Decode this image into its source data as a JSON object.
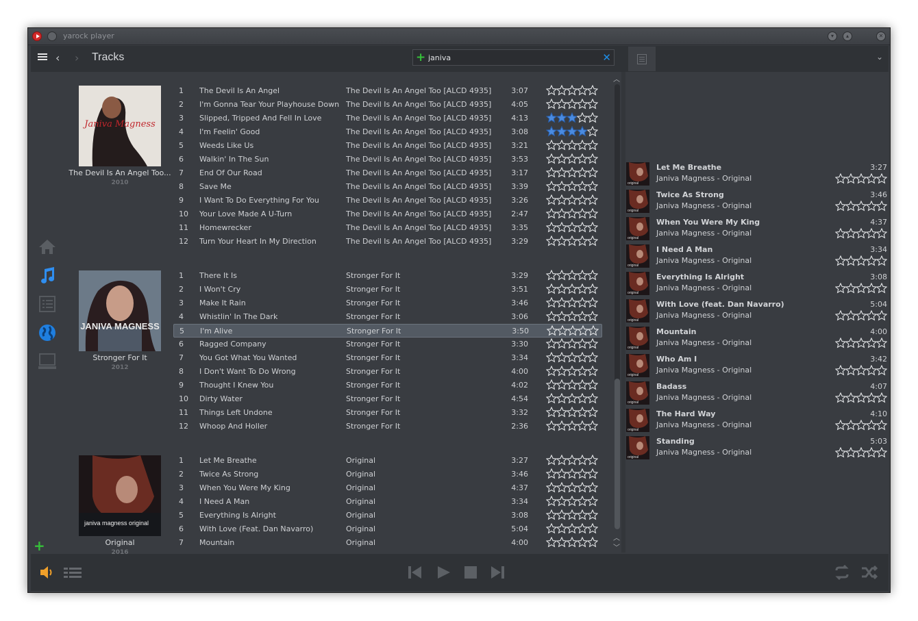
{
  "window": {
    "title": "yarock player"
  },
  "toolbar": {
    "page_title": "Tracks",
    "search_value": "janiva"
  },
  "colors": {
    "accent": "#1e8ee8",
    "add_green": "#36c03a",
    "volume_orange": "#f0a02a",
    "star_filled": "#4a8be0"
  },
  "sidebar": {
    "items": [
      {
        "name": "home",
        "icon": "home-icon"
      },
      {
        "name": "music",
        "icon": "music-note-icon",
        "active": true
      },
      {
        "name": "playlists",
        "icon": "list-icon"
      },
      {
        "name": "radio",
        "icon": "globe-icon"
      },
      {
        "name": "devices",
        "icon": "computer-icon"
      }
    ]
  },
  "albums": [
    {
      "title": "The Devil Is An Angel Too...",
      "year": "2010",
      "cover_text": "Janiva Magness",
      "tracks": [
        {
          "no": "1",
          "title": "The Devil Is An Angel",
          "album": "The Devil Is An Angel Too [ALCD 4935]",
          "duration": "3:07",
          "rating": 0
        },
        {
          "no": "2",
          "title": "I'm Gonna Tear Your Playhouse Down",
          "album": "The Devil Is An Angel Too [ALCD 4935]",
          "duration": "4:05",
          "rating": 0
        },
        {
          "no": "3",
          "title": "Slipped, Tripped And Fell In Love",
          "album": "The Devil Is An Angel Too [ALCD 4935]",
          "duration": "4:13",
          "rating": 3
        },
        {
          "no": "4",
          "title": "I'm Feelin' Good",
          "album": "The Devil Is An Angel Too [ALCD 4935]",
          "duration": "3:08",
          "rating": 4
        },
        {
          "no": "5",
          "title": "Weeds Like Us",
          "album": "The Devil Is An Angel Too [ALCD 4935]",
          "duration": "3:21",
          "rating": 0
        },
        {
          "no": "6",
          "title": "Walkin' In The Sun",
          "album": "The Devil Is An Angel Too [ALCD 4935]",
          "duration": "3:53",
          "rating": 0
        },
        {
          "no": "7",
          "title": "End Of Our Road",
          "album": "The Devil Is An Angel Too [ALCD 4935]",
          "duration": "3:17",
          "rating": 0
        },
        {
          "no": "8",
          "title": "Save Me",
          "album": "The Devil Is An Angel Too [ALCD 4935]",
          "duration": "3:39",
          "rating": 0
        },
        {
          "no": "9",
          "title": "I Want To Do Everything For You",
          "album": "The Devil Is An Angel Too [ALCD 4935]",
          "duration": "3:26",
          "rating": 0
        },
        {
          "no": "10",
          "title": "Your Love Made A U-Turn",
          "album": "The Devil Is An Angel Too [ALCD 4935]",
          "duration": "2:47",
          "rating": 0
        },
        {
          "no": "11",
          "title": "Homewrecker",
          "album": "The Devil Is An Angel Too [ALCD 4935]",
          "duration": "3:35",
          "rating": 0
        },
        {
          "no": "12",
          "title": "Turn Your Heart In My Direction",
          "album": "The Devil Is An Angel Too [ALCD 4935]",
          "duration": "3:29",
          "rating": 0
        }
      ]
    },
    {
      "title": "Stronger For It",
      "year": "2012",
      "cover_text": "JANIVA MAGNESS",
      "tracks": [
        {
          "no": "1",
          "title": "There It Is",
          "album": "Stronger For It",
          "duration": "3:29",
          "rating": 0
        },
        {
          "no": "2",
          "title": "I Won't Cry",
          "album": "Stronger For It",
          "duration": "3:51",
          "rating": 0
        },
        {
          "no": "3",
          "title": "Make It Rain",
          "album": "Stronger For It",
          "duration": "3:46",
          "rating": 0
        },
        {
          "no": "4",
          "title": "Whistlin' In The Dark",
          "album": "Stronger For It",
          "duration": "3:06",
          "rating": 0
        },
        {
          "no": "5",
          "title": "I'm Alive",
          "album": "Stronger For It",
          "duration": "3:50",
          "rating": 0,
          "selected": true
        },
        {
          "no": "6",
          "title": "Ragged Company",
          "album": "Stronger For It",
          "duration": "3:30",
          "rating": 0
        },
        {
          "no": "7",
          "title": "You Got What You Wanted",
          "album": "Stronger For It",
          "duration": "3:34",
          "rating": 0
        },
        {
          "no": "8",
          "title": "I Don't Want To Do Wrong",
          "album": "Stronger For It",
          "duration": "4:00",
          "rating": 0
        },
        {
          "no": "9",
          "title": "Thought I Knew You",
          "album": "Stronger For It",
          "duration": "4:02",
          "rating": 0
        },
        {
          "no": "10",
          "title": "Dirty Water",
          "album": "Stronger For It",
          "duration": "4:54",
          "rating": 0
        },
        {
          "no": "11",
          "title": "Things Left Undone",
          "album": "Stronger For It",
          "duration": "3:32",
          "rating": 0
        },
        {
          "no": "12",
          "title": "Whoop And Holler",
          "album": "Stronger For It",
          "duration": "2:36",
          "rating": 0
        }
      ]
    },
    {
      "title": "Original",
      "year": "2016",
      "cover_text": "janiva magness original",
      "tracks": [
        {
          "no": "1",
          "title": "Let Me Breathe",
          "album": "Original",
          "duration": "3:27",
          "rating": 0
        },
        {
          "no": "2",
          "title": "Twice As Strong",
          "album": "Original",
          "duration": "3:46",
          "rating": 0
        },
        {
          "no": "3",
          "title": "When You Were My King",
          "album": "Original",
          "duration": "4:37",
          "rating": 0
        },
        {
          "no": "4",
          "title": "I Need A Man",
          "album": "Original",
          "duration": "3:34",
          "rating": 0
        },
        {
          "no": "5",
          "title": "Everything Is Alright",
          "album": "Original",
          "duration": "3:08",
          "rating": 0
        },
        {
          "no": "6",
          "title": "With Love (Feat. Dan Navarro)",
          "album": "Original",
          "duration": "5:04",
          "rating": 0
        },
        {
          "no": "7",
          "title": "Mountain",
          "album": "Original",
          "duration": "4:00",
          "rating": 0
        }
      ]
    }
  ],
  "queue": [
    {
      "title": "Let Me Breathe",
      "subtitle": "Janiva Magness - Original",
      "duration": "3:27",
      "rating": 0
    },
    {
      "title": "Twice As Strong",
      "subtitle": "Janiva Magness - Original",
      "duration": "3:46",
      "rating": 0
    },
    {
      "title": "When You Were My King",
      "subtitle": "Janiva Magness - Original",
      "duration": "4:37",
      "rating": 0
    },
    {
      "title": "I Need A Man",
      "subtitle": "Janiva Magness - Original",
      "duration": "3:34",
      "rating": 0
    },
    {
      "title": "Everything Is Alright",
      "subtitle": "Janiva Magness - Original",
      "duration": "3:08",
      "rating": 0
    },
    {
      "title": "With Love (feat. Dan Navarro)",
      "subtitle": "Janiva Magness - Original",
      "duration": "5:04",
      "rating": 0
    },
    {
      "title": "Mountain",
      "subtitle": "Janiva Magness - Original",
      "duration": "4:00",
      "rating": 0
    },
    {
      "title": "Who Am I",
      "subtitle": "Janiva Magness - Original",
      "duration": "3:42",
      "rating": 0
    },
    {
      "title": "Badass",
      "subtitle": "Janiva Magness - Original",
      "duration": "4:07",
      "rating": 0
    },
    {
      "title": "The Hard Way",
      "subtitle": "Janiva Magness - Original",
      "duration": "4:10",
      "rating": 0
    },
    {
      "title": "Standing",
      "subtitle": "Janiva Magness - Original",
      "duration": "5:03",
      "rating": 0
    }
  ],
  "queue_thumb_text": "original"
}
